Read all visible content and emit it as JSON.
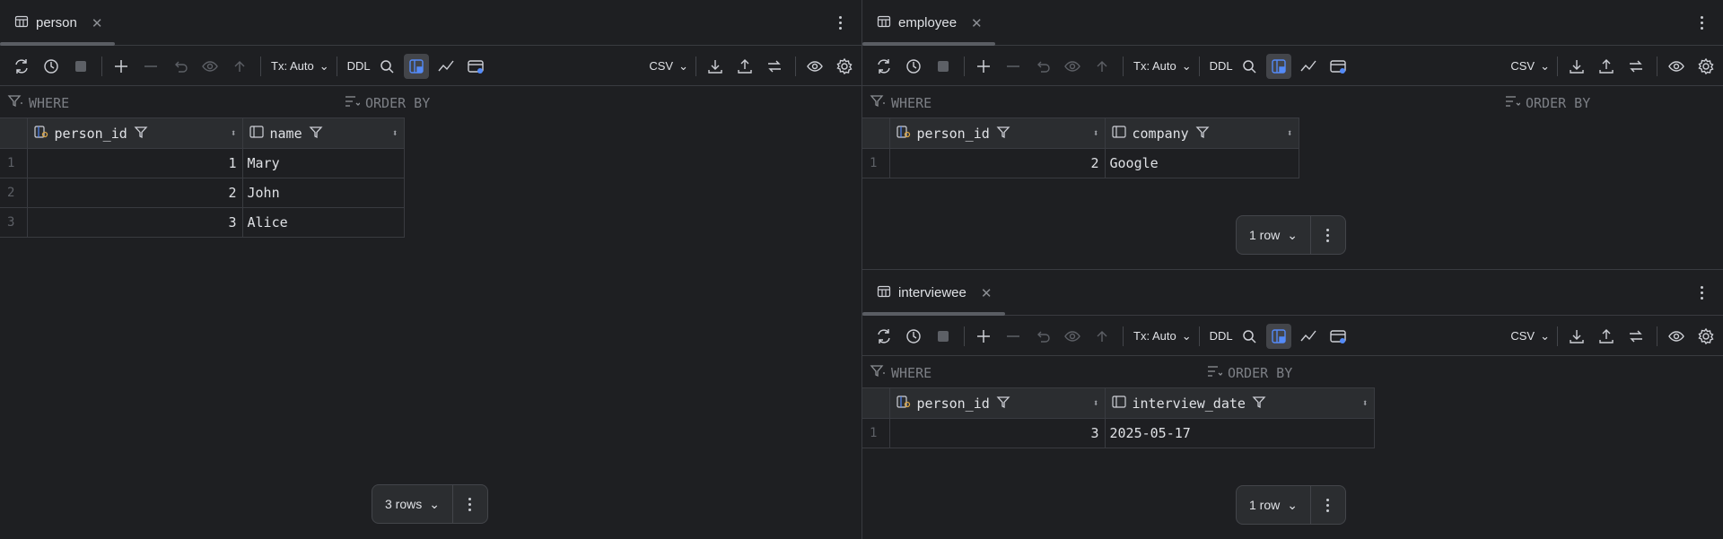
{
  "toolbar": {
    "tx_label": "Tx: Auto",
    "ddl_label": "DDL",
    "export_format": "CSV"
  },
  "filter": {
    "where_label": "WHERE",
    "order_by_label": "ORDER BY"
  },
  "panels": {
    "person": {
      "tab_title": "person",
      "columns": [
        "person_id",
        "name"
      ],
      "rows": [
        {
          "n": "1",
          "person_id": "1",
          "name": "Mary"
        },
        {
          "n": "2",
          "person_id": "2",
          "name": "John"
        },
        {
          "n": "3",
          "person_id": "3",
          "name": "Alice"
        }
      ],
      "row_count": "3 rows"
    },
    "employee": {
      "tab_title": "employee",
      "columns": [
        "person_id",
        "company"
      ],
      "rows": [
        {
          "n": "1",
          "person_id": "2",
          "company": "Google"
        }
      ],
      "row_count": "1 row"
    },
    "interviewee": {
      "tab_title": "interviewee",
      "columns": [
        "person_id",
        "interview_date"
      ],
      "rows": [
        {
          "n": "1",
          "person_id": "3",
          "interview_date": "2025-05-17"
        }
      ],
      "row_count": "1 row"
    }
  },
  "colors": {
    "background": "#1e1f22",
    "header_bg": "#2b2d30",
    "border": "#393b40",
    "key_icon": "#d9a343",
    "active_icon": "#548af7"
  }
}
